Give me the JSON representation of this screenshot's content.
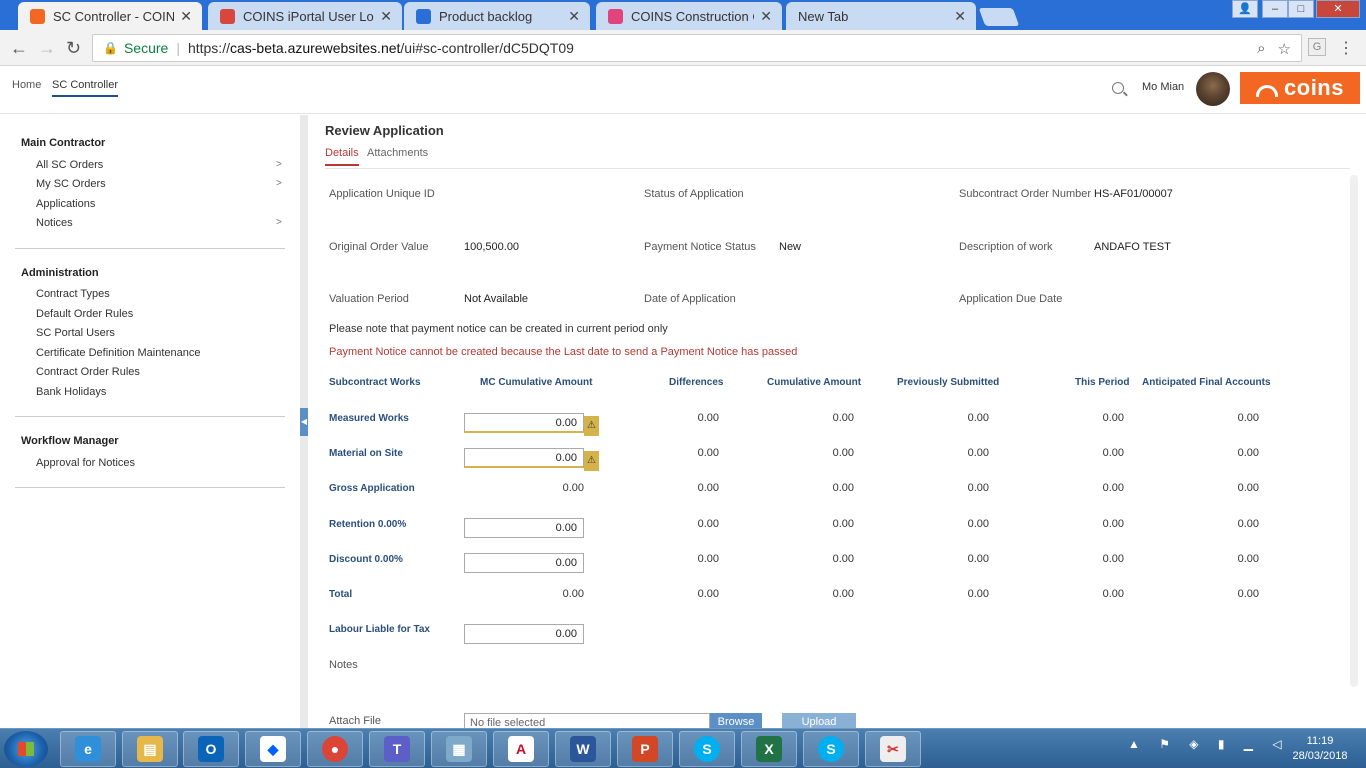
{
  "browser": {
    "tabs": [
      {
        "title": "SC Controller - COINS Co",
        "color": "#f26822"
      },
      {
        "title": "COINS iPortal User Login",
        "color": "#d9463b"
      },
      {
        "title": "Product backlog",
        "color": "#2a6fd6"
      },
      {
        "title": "COINS Construction Clou",
        "color": "#e0447c"
      },
      {
        "title": "New Tab",
        "color": ""
      }
    ],
    "secure_label": "Secure",
    "url_prefix": "https://",
    "url_host": "cas-beta.azurewebsites.net",
    "url_path": "/ui#sc-controller/dC5DQT09"
  },
  "header": {
    "nav": [
      "Home",
      "SC Controller"
    ],
    "user_name": "Mo Mian",
    "logo_text": "coins"
  },
  "sidebar": {
    "sections": [
      {
        "title": "Main Contractor",
        "items": [
          "All SC Orders",
          "My SC Orders",
          "Applications",
          "Notices"
        ]
      },
      {
        "title": "Administration",
        "items": [
          "Contract Types",
          "Default Order Rules",
          "SC Portal Users",
          "Certificate Definition Maintenance",
          "Contract Order Rules",
          "Bank Holidays"
        ]
      },
      {
        "title": "Workflow Manager",
        "items": [
          "Approval for Notices"
        ]
      }
    ]
  },
  "page": {
    "title": "Review Application",
    "tabs": [
      "Details",
      "Attachments"
    ]
  },
  "details": {
    "app_id_label": "Application Unique ID",
    "status_label": "Status of Application",
    "sc_order_label": "Subcontract Order Number",
    "sc_order_value": "HS-AF01/00007",
    "orig_value_label": "Original Order Value",
    "orig_value": "100,500.00",
    "pn_status_label": "Payment Notice Status",
    "pn_status_value": "New",
    "desc_label": "Description of work",
    "desc_value": "ANDAFO TEST",
    "val_period_label": "Valuation Period",
    "val_period_value": "Not Available",
    "date_app_label": "Date of Application",
    "due_date_label": "Application Due Date",
    "note": "Please note that payment notice can be created in current period only",
    "warning": "Payment Notice cannot be created because the Last date to send a Payment Notice has passed"
  },
  "table": {
    "headers": [
      "Subcontract Works",
      "MC Cumulative Amount",
      "Differences",
      "Cumulative Amount",
      "Previously Submitted",
      "This Period",
      "Anticipated Final Accounts"
    ],
    "rows": [
      {
        "label": "Measured Works",
        "mc": "0.00",
        "diff": "0.00",
        "cum": "0.00",
        "prev": "0.00",
        "this": "0.00",
        "afa": "0.00"
      },
      {
        "label": "Material on Site",
        "mc": "0.00",
        "diff": "0.00",
        "cum": "0.00",
        "prev": "0.00",
        "this": "0.00",
        "afa": "0.00"
      },
      {
        "label": "Gross Application",
        "mc": "0.00",
        "diff": "0.00",
        "cum": "0.00",
        "prev": "0.00",
        "this": "0.00",
        "afa": "0.00"
      },
      {
        "label": "Retention 0.00%",
        "mc": "0.00",
        "diff": "0.00",
        "cum": "0.00",
        "prev": "0.00",
        "this": "0.00",
        "afa": "0.00"
      },
      {
        "label": "Discount 0.00%",
        "mc": "0.00",
        "diff": "0.00",
        "cum": "0.00",
        "prev": "0.00",
        "this": "0.00",
        "afa": "0.00"
      },
      {
        "label": "Total",
        "mc": "0.00",
        "diff": "0.00",
        "cum": "0.00",
        "prev": "0.00",
        "this": "0.00",
        "afa": "0.00"
      }
    ],
    "labour_label": "Labour Liable for Tax",
    "labour_value": "0.00"
  },
  "footer_form": {
    "notes_label": "Notes",
    "attach_label": "Attach File",
    "file_placeholder": "No file selected",
    "browse_label": "Browse",
    "upload_label": "Upload"
  },
  "taskbar": {
    "time": "11:19",
    "date": "28/03/2018"
  }
}
